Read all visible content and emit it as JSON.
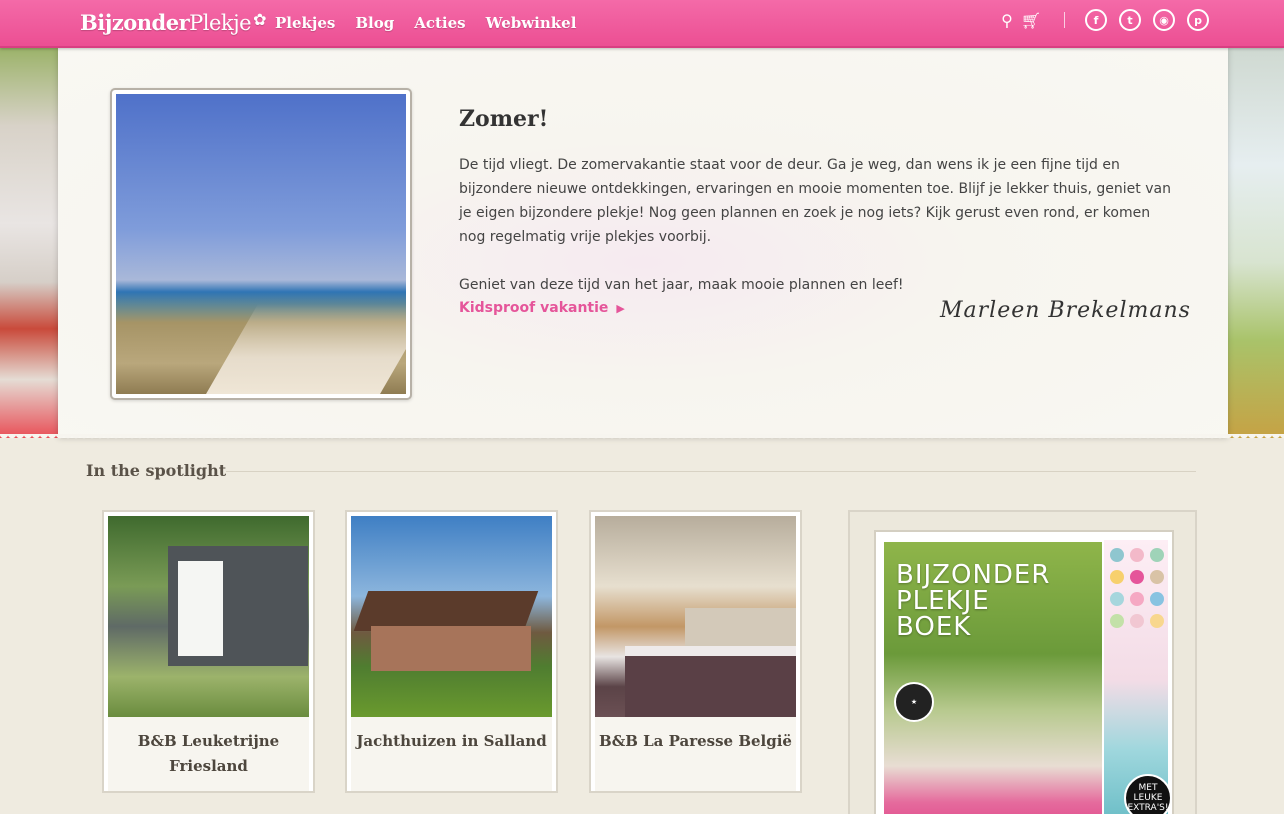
{
  "header": {
    "logo_bold": "Bijzonder",
    "logo_light": "Plekje",
    "nav": [
      "Plekjes",
      "Blog",
      "Acties",
      "Webwinkel"
    ],
    "icons": [
      "search-icon",
      "cart-icon",
      "facebook-icon",
      "twitter-icon",
      "instagram-icon",
      "pinterest-icon"
    ]
  },
  "hero": {
    "title": "Zomer!",
    "paragraph1": "De tijd vliegt. De zomervakantie staat voor de deur. Ga je weg, dan wens ik je een fijne tijd en bijzondere nieuwe ontdekkingen, ervaringen en mooie momenten toe. Blijf je lekker thuis, geniet van je eigen bijzondere plekje! Nog geen plannen en zoek je nog iets? Kijk gerust even rond, er komen nog regelmatig vrije plekjes voorbij.",
    "paragraph2": "Geniet van deze tijd van het jaar, maak mooie plannen en leef!",
    "link": "Kidsproof vakantie",
    "signature": "Marleen Brekelmans"
  },
  "spotlight": {
    "title": "In the spotlight",
    "cards": [
      {
        "caption": "B&B Leuketrijne Friesland"
      },
      {
        "caption": "Jachthuizen in Salland"
      },
      {
        "caption": "B&B La Paresse België"
      }
    ]
  },
  "book": {
    "title_line1": "BIJZONDER",
    "title_line2": "PLEKJE",
    "title_line3": "BOEK",
    "badge": "MET LEUKE EXTRA'S!"
  },
  "colors": {
    "accent": "#ec4f93",
    "link": "#e5559a",
    "background": "#efebe0"
  }
}
